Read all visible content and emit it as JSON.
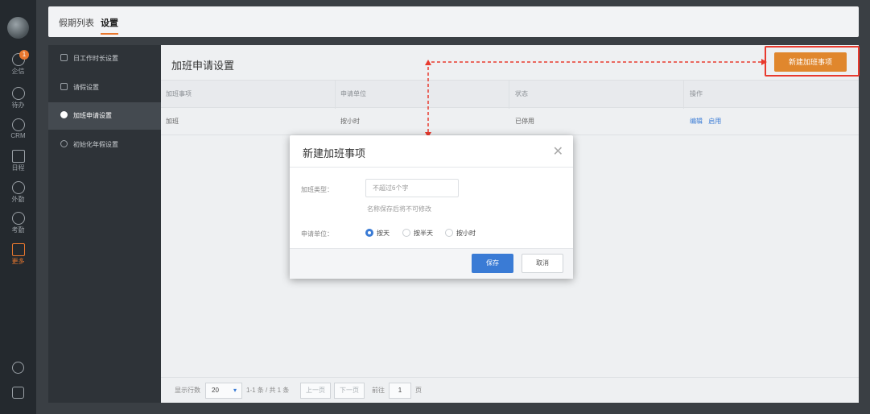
{
  "rail": {
    "items": [
      {
        "label": "企信",
        "badge": "1"
      },
      {
        "label": "待办"
      },
      {
        "label": "CRM"
      },
      {
        "label": "日程"
      },
      {
        "label": "外勤"
      },
      {
        "label": "考勤"
      },
      {
        "label": "更多"
      }
    ],
    "active_color": "#e8772e"
  },
  "topbar": {
    "tabs": [
      {
        "label": "假期列表"
      },
      {
        "label": "设置"
      }
    ],
    "active_tab": "设置"
  },
  "sidebar": {
    "items": [
      {
        "label": "日工作时长设置"
      },
      {
        "label": "请假设置"
      },
      {
        "label": "加班申请设置"
      },
      {
        "label": "初始化年假设置"
      }
    ],
    "active": "加班申请设置"
  },
  "main": {
    "title": "加班申请设置",
    "new_button": "新建加班事项",
    "columns": [
      "加班事项",
      "申请单位",
      "状态",
      "操作"
    ],
    "rows": [
      {
        "item": "加班",
        "unit": "按小时",
        "status": "已停用",
        "actions": [
          "编辑",
          "启用"
        ]
      }
    ],
    "pager": {
      "rows_label": "显示行数",
      "rows_value": "20",
      "summary": "1-1 条 / 共 1 条",
      "prev": "上一页",
      "next": "下一页",
      "goto_label": "前往",
      "page": "1",
      "page_suffix": "页"
    }
  },
  "modal": {
    "title": "新建加班事项",
    "type_label": "加班类型：",
    "type_placeholder": "不超过6个字",
    "hint": "名称保存后将不可修改",
    "unit_label": "申请单位：",
    "options": [
      "按天",
      "按半天",
      "按小时"
    ],
    "selected_option": "按天",
    "save": "保存",
    "cancel": "取消"
  },
  "colors": {
    "accent": "#e0872d",
    "primary": "#3a7bd5",
    "annotation": "#e83a2e"
  }
}
